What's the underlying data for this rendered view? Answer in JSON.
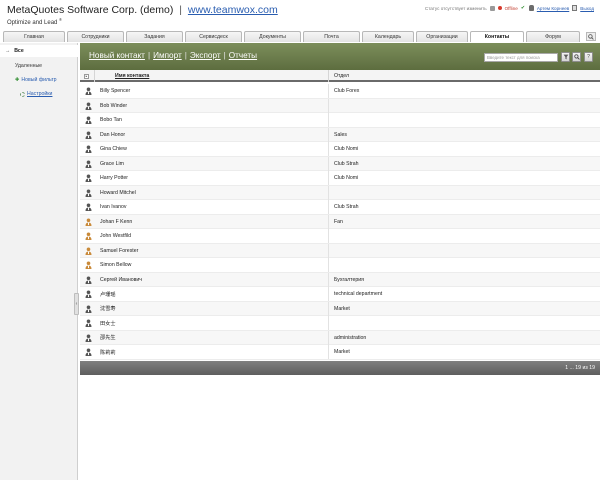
{
  "header": {
    "company": "MetaQuotes Software Corp. (demo)",
    "separator": "|",
    "site": "www.teamwox.com",
    "tagline": "Optimize and Lead",
    "tagline_mark": "®",
    "status_hint": "Статус отсутствует изменить",
    "offline": "Offline",
    "user_name": "Артем Корнеев",
    "exit": "Выход"
  },
  "tabs": [
    {
      "label": "Главная",
      "active": false
    },
    {
      "label": "Сотрудники",
      "active": false
    },
    {
      "label": "Задания",
      "active": false
    },
    {
      "label": "Сервисдеск",
      "active": false
    },
    {
      "label": "Документы",
      "active": false
    },
    {
      "label": "Почта",
      "active": false
    },
    {
      "label": "Календарь",
      "active": false
    },
    {
      "label": "Организации",
      "active": false
    },
    {
      "label": "Контакты",
      "active": true
    },
    {
      "label": "Форум",
      "active": false
    }
  ],
  "sidebar": {
    "all": "Все",
    "deleted": "Удаленные",
    "new_filter": "Новый фильтр",
    "settings": "Настройки",
    "collapse_glyph": "‹"
  },
  "toolbar": {
    "new_contact": "Новый контакт",
    "import": "Импорт",
    "export": "Экспорт",
    "reports": "Отчеты",
    "sep": "|",
    "search_placeholder": "Введите текст для поиска"
  },
  "table": {
    "col_name": "Имя контакта",
    "col_dept": "Отдел",
    "rows": [
      {
        "name": "Billy Spencer",
        "dept": "Club Forex",
        "gender": "m"
      },
      {
        "name": "Bob Winder",
        "dept": "",
        "gender": "m"
      },
      {
        "name": "Bobo Tan",
        "dept": "",
        "gender": "m"
      },
      {
        "name": "Dan Honor",
        "dept": "Sales",
        "gender": "m"
      },
      {
        "name": "Gina Chiew",
        "dept": "Club Nomi",
        "gender": "m"
      },
      {
        "name": "Grace Lim",
        "dept": "Club Strah",
        "gender": "m"
      },
      {
        "name": "Harry Potter",
        "dept": "Club Nomi",
        "gender": "m"
      },
      {
        "name": "Howard Mitchel",
        "dept": "",
        "gender": "m"
      },
      {
        "name": "Ivan Ivanov",
        "dept": "Club Strah",
        "gender": "m"
      },
      {
        "name": "Johan F Kenn",
        "dept": "Fan",
        "gender": "f"
      },
      {
        "name": "John Westfild",
        "dept": "",
        "gender": "f"
      },
      {
        "name": "Samuel Forester",
        "dept": "",
        "gender": "f"
      },
      {
        "name": "Simon Bellow",
        "dept": "",
        "gender": "f"
      },
      {
        "name": "Сергей Иванович",
        "dept": "Бухгалтерия",
        "gender": "m"
      },
      {
        "name": "卢珊瑶",
        "dept": "technical department",
        "gender": "m"
      },
      {
        "name": "沈雪寿",
        "dept": "Market",
        "gender": "m"
      },
      {
        "name": "田女士",
        "dept": "",
        "gender": "m"
      },
      {
        "name": "邵先生",
        "dept": "administration",
        "gender": "m"
      },
      {
        "name": "陈莉莉",
        "dept": "Market",
        "gender": "m"
      }
    ]
  },
  "pager": "1 ... 19 из 19",
  "colors": {
    "toolbar": "#6f7f4f",
    "link": "#2a5db0",
    "footer": "#6e6e6e"
  }
}
